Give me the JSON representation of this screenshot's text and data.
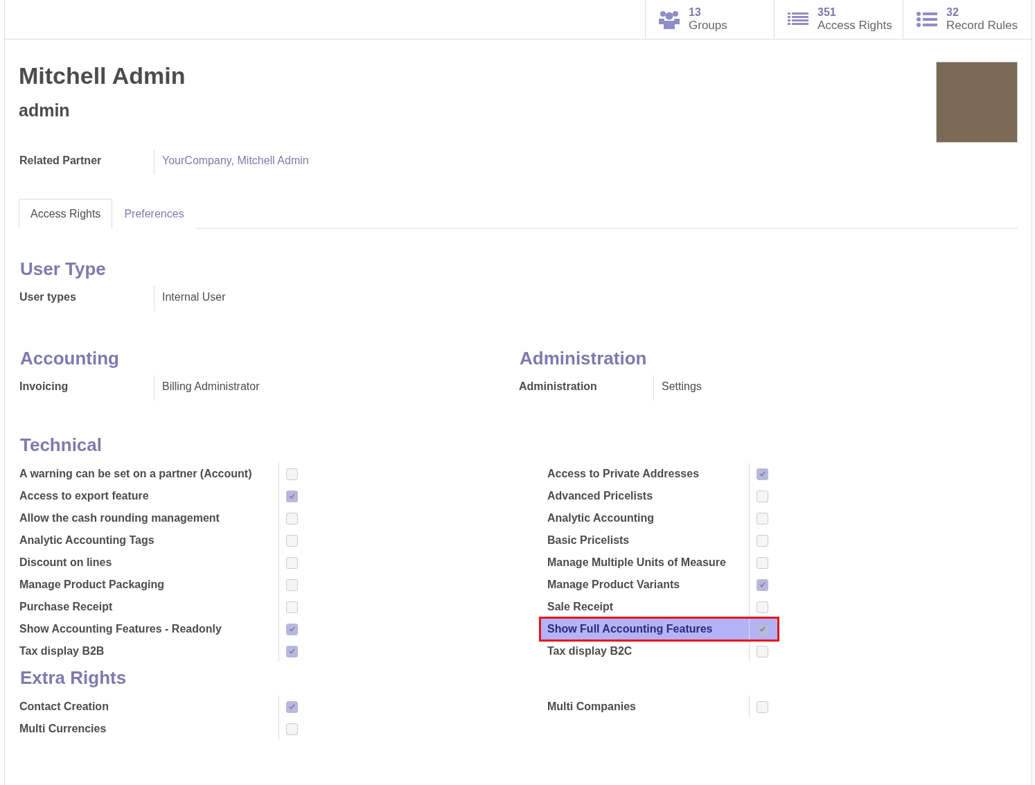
{
  "stat_buttons": [
    {
      "kind": "groups",
      "count": "13",
      "label": "Groups"
    },
    {
      "kind": "list",
      "count": "351",
      "label": "Access Rights"
    },
    {
      "kind": "bullets",
      "count": "32",
      "label": "Record Rules"
    }
  ],
  "user": {
    "name": "Mitchell Admin",
    "login": "admin"
  },
  "related_partner": {
    "label": "Related Partner",
    "value": "YourCompany, Mitchell Admin"
  },
  "tabs": [
    {
      "label": "Access Rights",
      "selected": true
    },
    {
      "label": "Preferences",
      "selected": false
    }
  ],
  "user_type": {
    "title": "User Type",
    "fields": [
      {
        "label": "User types",
        "value": "Internal User"
      }
    ]
  },
  "app_sections": [
    {
      "title": "Accounting",
      "fields": [
        {
          "label": "Invoicing",
          "value": "Billing Administrator"
        }
      ]
    },
    {
      "title": "Administration",
      "fields": [
        {
          "label": "Administration",
          "value": "Settings"
        }
      ]
    }
  ],
  "checkbox_sections": [
    {
      "title": "Technical",
      "left": [
        {
          "label": "A warning can be set on a partner (Account)",
          "checked": false,
          "highlighted": false
        },
        {
          "label": "Access to export feature",
          "checked": true,
          "highlighted": false
        },
        {
          "label": "Allow the cash rounding management",
          "checked": false,
          "highlighted": false
        },
        {
          "label": "Analytic Accounting Tags",
          "checked": false,
          "highlighted": false
        },
        {
          "label": "Discount on lines",
          "checked": false,
          "highlighted": false
        },
        {
          "label": "Manage Product Packaging",
          "checked": false,
          "highlighted": false
        },
        {
          "label": "Purchase Receipt",
          "checked": false,
          "highlighted": false
        },
        {
          "label": "Show Accounting Features - Readonly",
          "checked": true,
          "highlighted": false
        },
        {
          "label": "Tax display B2B",
          "checked": true,
          "highlighted": false
        }
      ],
      "right": [
        {
          "label": "Access to Private Addresses",
          "checked": true,
          "highlighted": false
        },
        {
          "label": "Advanced Pricelists",
          "checked": false,
          "highlighted": false
        },
        {
          "label": "Analytic Accounting",
          "checked": false,
          "highlighted": false
        },
        {
          "label": "Basic Pricelists",
          "checked": false,
          "highlighted": false
        },
        {
          "label": "Manage Multiple Units of Measure",
          "checked": false,
          "highlighted": false
        },
        {
          "label": "Manage Product Variants",
          "checked": true,
          "highlighted": false
        },
        {
          "label": "Sale Receipt",
          "checked": false,
          "highlighted": false
        },
        {
          "label": "Show Full Accounting Features",
          "checked": true,
          "highlighted": true
        },
        {
          "label": "Tax display B2C",
          "checked": false,
          "highlighted": false
        }
      ]
    },
    {
      "title": "Extra Rights",
      "left": [
        {
          "label": "Contact Creation",
          "checked": true,
          "highlighted": false
        },
        {
          "label": "Multi Currencies",
          "checked": false,
          "highlighted": false
        }
      ],
      "right": [
        {
          "label": "Multi Companies",
          "checked": false,
          "highlighted": false
        }
      ]
    }
  ]
}
